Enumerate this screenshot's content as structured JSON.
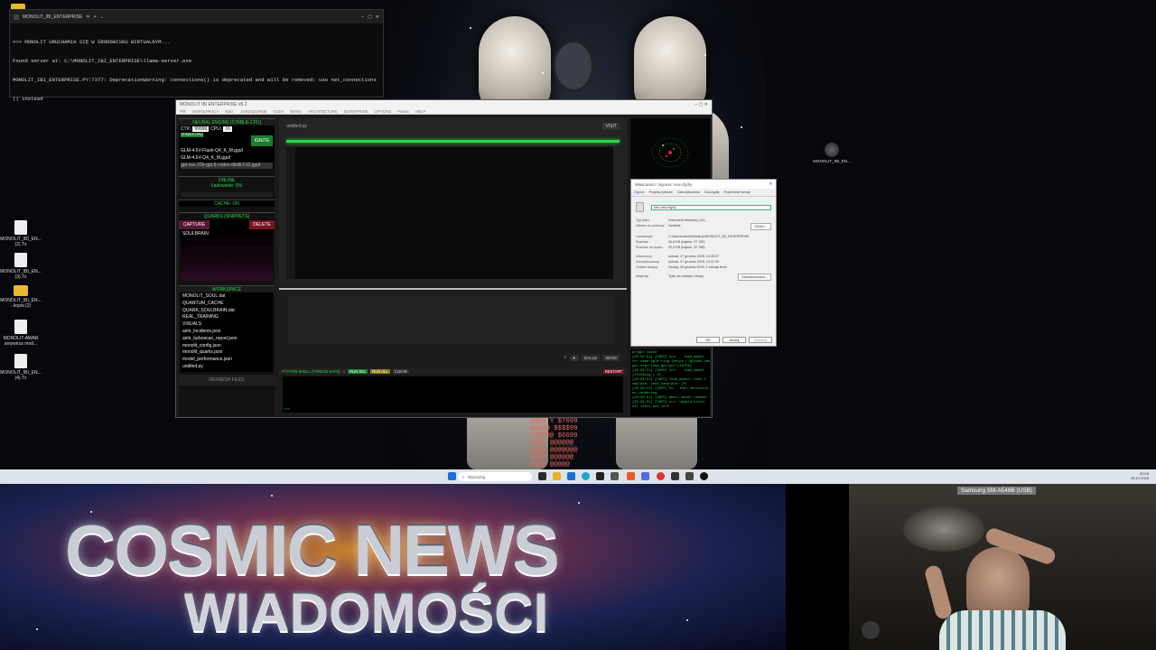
{
  "cmd": {
    "title": "MONOLIT_IBI_ENTERPRISE",
    "lines": [
      ">>> MONOLIT URUCHAMIA SIĘ W ŚRODOWISKU WIRTUALNYM...",
      "Found server at: C:\\MONOLIT_IBI_ENTERPRISE\\llama-server.exe",
      "MONOLIT_IBI_ENTERPRISE.PY:7377: DeprecationWarning: connections() is deprecated and will be removed; use net_connections",
      "() instead"
    ]
  },
  "desktop_icons": [
    {
      "label": "MONOLIT_IBI_EN... (2).Tx",
      "kind": "file"
    },
    {
      "label": "MONOLIT_IBI_EN... (3).Tx",
      "kind": "file"
    },
    {
      "label": "MONOLIT_IBI_EN... - kopia (2)",
      "kind": "folder"
    },
    {
      "label": "MONOLIT-AWAR antywirus mod...",
      "kind": "file"
    },
    {
      "label": "MONOLIT_IBI_EN... (4).Tx",
      "kind": "file"
    }
  ],
  "desktop_right_icon": "MONOLIT_IBI_EN...",
  "app": {
    "title": "MONOLIT IBI ENTERPRISE v8.2",
    "menu": [
      "Plik",
      "WSPÓŁPRACA",
      "Narz.",
      "ZARZĄDZANIE",
      "CUDA",
      "NEWS",
      "ARCHITECTURE",
      "ENTERPRISE",
      "OPTIONS",
      "Pomoc",
      "HELP"
    ],
    "engine_header": "NEURAL ENGINE [STABLE-CPU]",
    "ctx_label": "CTX:",
    "ctx_value": "99999",
    "cpu_label": "CPU:",
    "cpu_value": "16",
    "stable_badge": "[STABLE CPU]",
    "ignite_label": "IGNITE",
    "models": [
      "GLM-4.6V-Flash-Q4_K_M.gguf",
      "GLM-4.6V-Q4_K_M.gguf",
      "gpt-oss-20b-gpt-5-codex-distill.F16.gguf"
    ],
    "status_online": "ONLINE",
    "status_loading": "Ładowanie: 0%",
    "cache_label": "CACHE: ON",
    "quarks_header": "QUARKS (SNIPPETS)",
    "capture_label": "CAPTURE",
    "delete_label": "DELETE",
    "quark_items": [
      "SOULBRAIN"
    ],
    "workspace_header": "WORKSPACE",
    "workspace_files": [
      "MONOLIT_SOUL.dat",
      "QUANTUM_CACHE",
      "QUARK_SOULBRAIN.dat",
      "REAL_TRAINING",
      "VISUALS",
      "airiir_incidents.json",
      "airiir_turboscan_report.json",
      "monolit_config.json",
      "monolit_quarks.json",
      "model_performance.json",
      "untitled.py"
    ],
    "refresh_label": "REFRESH FILES",
    "editor_tab": "untitled.py",
    "editor_btn": "VISIT",
    "output_buttons": [
      "DALLE",
      "SEND"
    ],
    "shell_title": "PYTHON SHELL [THREAD SAFE]",
    "shell_buttons": [
      "RUN SEL",
      "RUN ALL",
      "CLEAR"
    ],
    "restart_label": "RESTART",
    "shell_prompt": ">>>",
    "console_lines": [
      "prompt cache",
      "[20:02:51] [INFO] srv    load_model",
      "for some ogle ring [https://github.com",
      "gov.ergl/ikan_gov/pull/16759]",
      "[20:02:51] [INFO] srv    load_model",
      "[thinking = 0]",
      "[20:02:51] [INFO] load_model: chat t",
      "emplate, chat_template: {%",
      "[20:02:51] [INFO] Sv.  tool definitio",
      "ns_rendering",
      "[20:02:51] [INFO] main: model loaded",
      "[20:02:51] [INFO] srv  update_slots:",
      "all slots are idle"
    ]
  },
  "properties": {
    "title": "Właściwości: ingoexit: new.cfg/hy",
    "tabs": [
      "Ogólne",
      "Podpisy cyfrowe",
      "Zabezpieczenia",
      "Szczegóły",
      "Poprzednie wersje"
    ],
    "filename": "ideo.new.cfg/hy",
    "rows": [
      {
        "k": "Typ pliku:",
        "v": "Dokument tekstowy (.txt)"
      },
      {
        "k": "Otwórz za pomocą:",
        "v": "Notatnik"
      },
      {
        "k": "Lokalizacja:",
        "v": "C:\\Users\\Jacek\\Desktop\\MONOLIT_IBI_ENTERPRISE"
      },
      {
        "k": "Rozmiar:",
        "v": "26,8 KB (bajtów: 27 150)"
      },
      {
        "k": "Rozmiar na dysku:",
        "v": "32,0 KB (bajtów: 32 768)"
      },
      {
        "k": "Utworzony:",
        "v": "sobota, 27 grudnia 2025, 10:28:27"
      },
      {
        "k": "Zmodyfikowany:",
        "v": "sobota, 27 grudnia 2025, 10:47:40"
      },
      {
        "k": "Ostatni dostęp:",
        "v": "Dzisiaj, 28 grudnia 2025, 1 minutę temu"
      },
      {
        "k": "Atrybuty:",
        "v": "Tylko do odczytu   Ukryty"
      }
    ],
    "change_label": "Zmień...",
    "advanced_label": "Zaawansowane...",
    "ok_label": "OK",
    "cancel_label": "Anuluj",
    "apply_label": "Zastosuj"
  },
  "overlay_numbers": [
    "@@@4 Y $7699",
    "@@@@@ $$$$99",
    "@@@@@@ $6699",
    "@@@@ @@@@@@",
    "@@@@ @@@@@@@",
    "@@@@ @@@@@@",
    "@@@@ @@@@@"
  ],
  "taskbar": {
    "search_placeholder": "Wyszukaj",
    "time": "20:03",
    "date": "28.12.2025"
  },
  "banner": {
    "title": "COSMIC NEWS",
    "subtitle": "WIADOMOŚCI"
  },
  "camera": {
    "label": "Samsung SM-A546B (USB)"
  },
  "colors": {
    "accent_green": "#2ed64a",
    "capture_pink": "#5a1836",
    "delete_red": "#7a1420",
    "taskbar": "#dde3ea"
  }
}
